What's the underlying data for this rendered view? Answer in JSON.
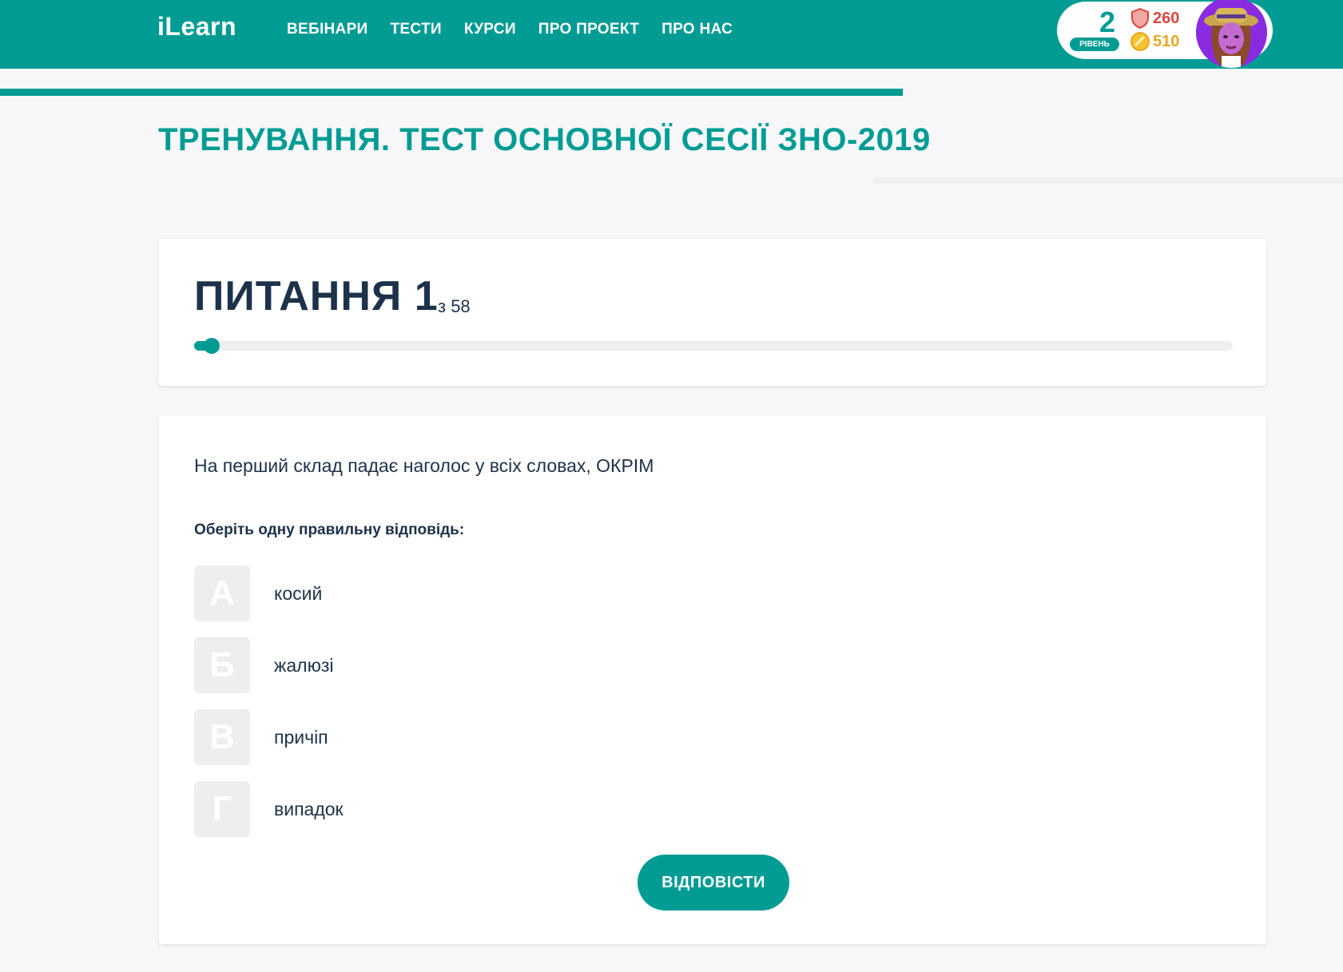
{
  "header": {
    "logo": "iLearn",
    "nav": [
      {
        "label": "ВЕБІНАРИ"
      },
      {
        "label": "ТЕСТИ"
      },
      {
        "label": "КУРСИ"
      },
      {
        "label": "ПРО ПРОЕКТ"
      },
      {
        "label": "ПРО НАС"
      }
    ],
    "profile": {
      "level": "2",
      "level_label": "РІВЕНЬ",
      "shield_points": "260",
      "coins": "510"
    }
  },
  "page": {
    "title": "ТРЕНУВАННЯ. ТЕСТ ОСНОВНОЇ СЕСІЇ ЗНО-2019"
  },
  "progress": {
    "heading": "ПИТАННЯ 1",
    "of_label": "з 58",
    "current": 1,
    "total": 58
  },
  "question": {
    "text": "На перший склад падає наголос у всіх словах, ОКРІМ",
    "instruction": "Оберіть одну правильну відповідь:",
    "options": [
      {
        "letter": "А",
        "label": "косий"
      },
      {
        "letter": "Б",
        "label": "жалюзі"
      },
      {
        "letter": "В",
        "label": "причіп"
      },
      {
        "letter": "Г",
        "label": "випадок"
      }
    ],
    "answer_button": "ВІДПОВІСТИ"
  },
  "colors": {
    "brand": "#009c94",
    "heading": "#1c324a",
    "shield": "#d9473f",
    "coin": "#e9a823"
  }
}
